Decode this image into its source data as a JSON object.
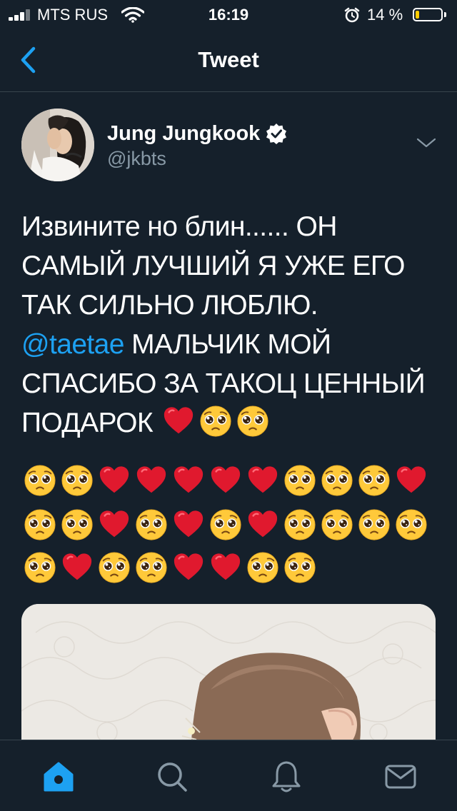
{
  "status_bar": {
    "carrier": "MTS RUS",
    "time": "16:19",
    "battery_text": "14 %",
    "battery_level": 0.14,
    "battery_color": "#ffcc00",
    "icons": [
      "signal-icon",
      "wifi-icon",
      "alarm-icon",
      "battery-icon"
    ]
  },
  "nav": {
    "title": "Tweet",
    "back_icon": "chevron-left-icon"
  },
  "tweet": {
    "author": {
      "display_name": "Jung Jungkook",
      "handle": "@jkbts",
      "verified": true
    },
    "text_before_mention": "Извините но блин...... ОН САМЫЙ ЛУЧШИЙ Я УЖЕ ЕГО ТАК СИЛЬНО ЛЮБЛЮ.\n",
    "mention": "@taetae",
    "text_after_mention": " МАЛЬЧИК МОЙ СПАСИБО ЗА ТАКОЦ ЦЕННЫЙ ПОДАРОК ",
    "emoji_line_1": [
      "heart",
      "pleading",
      "pleading"
    ],
    "emoji_rows": [
      [
        "pleading",
        "pleading",
        "heart",
        "heart",
        "heart",
        "heart",
        "heart",
        "pleading",
        "pleading",
        "pleading",
        "heart"
      ],
      [
        "pleading",
        "pleading",
        "heart",
        "pleading",
        "heart",
        "pleading",
        "heart",
        "pleading",
        "pleading",
        "pleading",
        "pleading"
      ],
      [
        "pleading",
        "heart",
        "pleading",
        "pleading",
        "heart",
        "heart",
        "pleading",
        "pleading"
      ]
    ],
    "media_description_icon": "photo-icon"
  },
  "tab_bar": {
    "tabs": [
      {
        "name": "home-icon",
        "active": true
      },
      {
        "name": "search-icon",
        "active": false
      },
      {
        "name": "notifications-icon",
        "active": false
      },
      {
        "name": "messages-icon",
        "active": false
      }
    ]
  },
  "colors": {
    "background": "#15202b",
    "accent": "#1da1f2",
    "secondary_text": "#8899a6",
    "divider": "#38444d",
    "heart": "#e0192e",
    "pleading_face": "#ffc93a"
  }
}
